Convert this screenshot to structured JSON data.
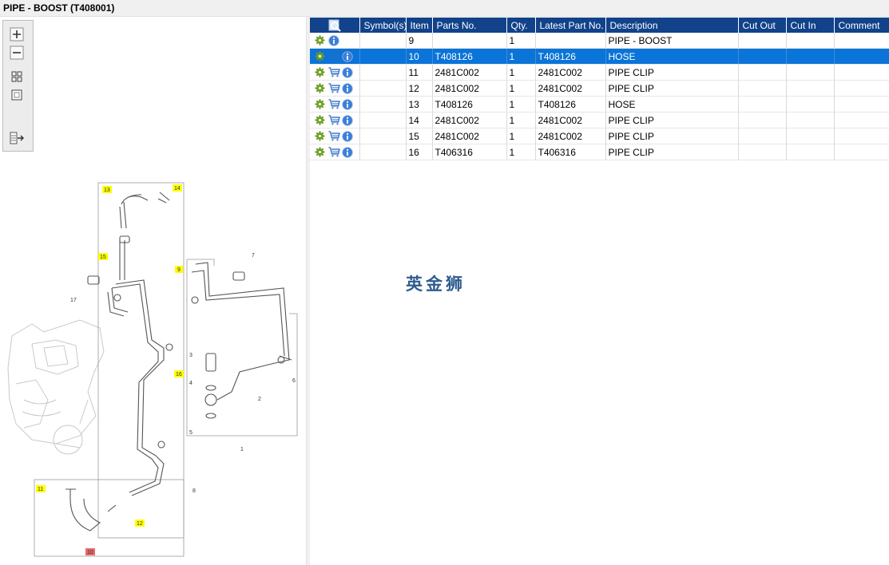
{
  "window": {
    "title": "PIPE - BOOST (T408001)"
  },
  "toolbar": {
    "buttons": [
      {
        "icon": "zoom-in-icon"
      },
      {
        "icon": "zoom-out-icon"
      },
      {
        "icon": "fit-all-icon"
      },
      {
        "icon": "actual-size-icon"
      },
      {
        "icon": "export-icon"
      }
    ]
  },
  "diagram": {
    "callouts": [
      "13",
      "14",
      "15",
      "9",
      "7",
      "17",
      "3",
      "4",
      "5",
      "6",
      "2",
      "1",
      "16",
      "8",
      "11",
      "12",
      "10"
    ]
  },
  "grid": {
    "columns": {
      "symbols": "Symbol(s)",
      "item": "Item",
      "parts_no": "Parts No.",
      "qty": "Qty.",
      "latest": "Latest Part No.",
      "description": "Description",
      "cut_out": "Cut Out",
      "cut_in": "Cut In",
      "comment": "Comment"
    },
    "rows": [
      {
        "item": "9",
        "parts_no": "",
        "qty": "1",
        "latest": "",
        "description": "PIPE - BOOST",
        "cart": false,
        "selected": false
      },
      {
        "item": "10",
        "parts_no": "T408126",
        "qty": "1",
        "latest": "T408126",
        "description": "HOSE",
        "cart": true,
        "selected": true
      },
      {
        "item": "11",
        "parts_no": "2481C002",
        "qty": "1",
        "latest": "2481C002",
        "description": "PIPE CLIP",
        "cart": true,
        "selected": false
      },
      {
        "item": "12",
        "parts_no": "2481C002",
        "qty": "1",
        "latest": "2481C002",
        "description": "PIPE CLIP",
        "cart": true,
        "selected": false
      },
      {
        "item": "13",
        "parts_no": "T408126",
        "qty": "1",
        "latest": "T408126",
        "description": "HOSE",
        "cart": true,
        "selected": false
      },
      {
        "item": "14",
        "parts_no": "2481C002",
        "qty": "1",
        "latest": "2481C002",
        "description": "PIPE CLIP",
        "cart": true,
        "selected": false
      },
      {
        "item": "15",
        "parts_no": "2481C002",
        "qty": "1",
        "latest": "2481C002",
        "description": "PIPE CLIP",
        "cart": true,
        "selected": false
      },
      {
        "item": "16",
        "parts_no": "T406316",
        "qty": "1",
        "latest": "T406316",
        "description": "PIPE CLIP",
        "cart": true,
        "selected": false
      }
    ]
  },
  "watermark": "英金狮",
  "colors": {
    "header": "#11428a",
    "selected_row": "#0a74d8",
    "callout_highlight": "#ffff00",
    "callout_selected": "#e86a6a"
  }
}
